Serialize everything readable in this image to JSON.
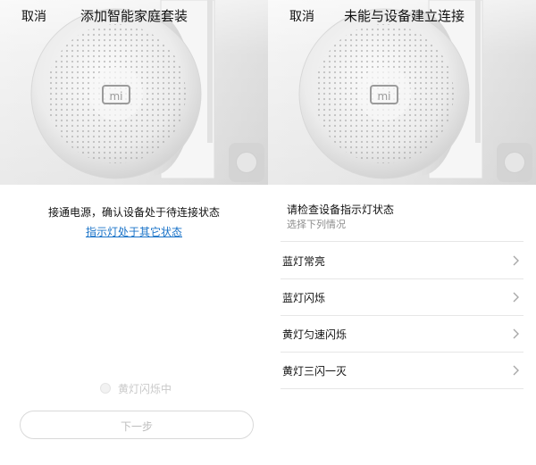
{
  "left": {
    "cancel": "取消",
    "title": "添加智能家庭套装",
    "instruction": "接通电源，确认设备处于待连接状态",
    "link": "指示灯处于其它状态",
    "status_label": "黄灯闪烁中",
    "next_button": "下一步"
  },
  "right": {
    "cancel": "取消",
    "title": "未能与设备建立连接",
    "heading": "请检查设备指示灯状态",
    "subheading": "选择下列情况",
    "options": [
      {
        "label": "蓝灯常亮"
      },
      {
        "label": "蓝灯闪烁"
      },
      {
        "label": "黄灯匀速闪烁"
      },
      {
        "label": "黄灯三闪一灭"
      }
    ]
  },
  "colors": {
    "link": "#1a73c8",
    "text": "#111111",
    "muted": "#8d8d8d",
    "disabled": "#bdbdbd",
    "divider": "#e6e6e6"
  },
  "icons": {
    "chevron": "chevron-right-icon",
    "device": "mi-logo-icon"
  }
}
